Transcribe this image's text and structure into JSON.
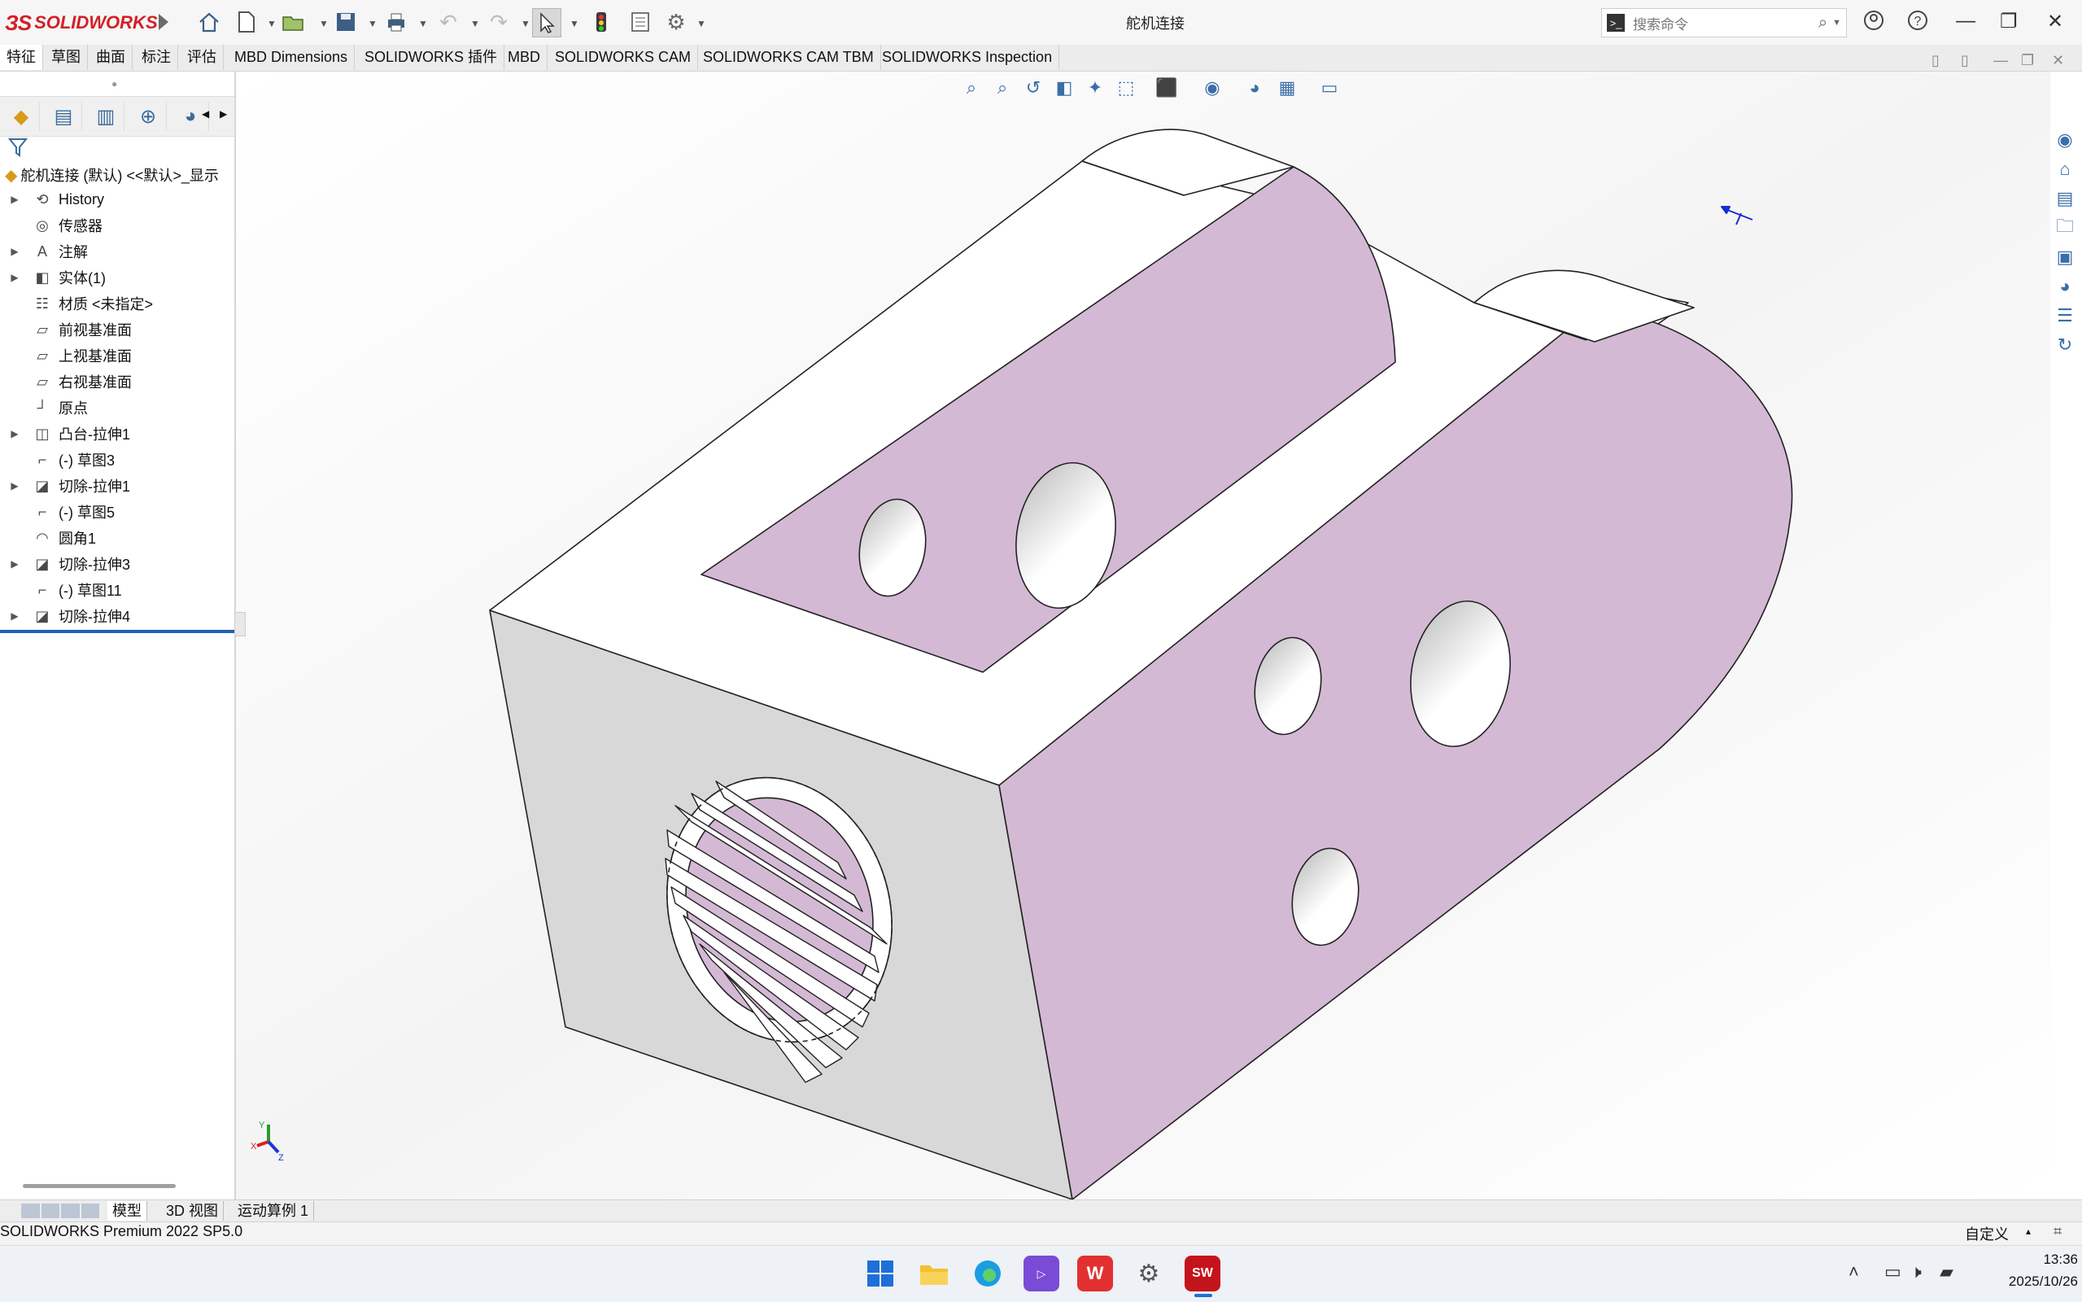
{
  "app": {
    "logo_ds": "ЗS",
    "logo_text": "SOLIDWORKS",
    "document_title": "舵机连接",
    "search_placeholder": "搜索命令"
  },
  "command_tabs": [
    "特征",
    "草图",
    "曲面",
    "标注",
    "评估",
    "MBD Dimensions",
    "SOLIDWORKS 插件",
    "MBD",
    "SOLIDWORKS CAM",
    "SOLIDWORKS CAM TBM",
    "SOLIDWORKS Inspection"
  ],
  "feature_tree": {
    "root": "舵机连接 (默认) <<默认>_显示",
    "items": [
      {
        "label": "History",
        "icon": "history-icon",
        "expandable": true
      },
      {
        "label": "传感器",
        "icon": "sensor-icon",
        "expandable": false
      },
      {
        "label": "注解",
        "icon": "annotation-icon",
        "expandable": true
      },
      {
        "label": "实体(1)",
        "icon": "solid-bodies-icon",
        "expandable": true
      },
      {
        "label": "材质 <未指定>",
        "icon": "material-icon",
        "expandable": false
      },
      {
        "label": "前视基准面",
        "icon": "plane-icon",
        "expandable": false
      },
      {
        "label": "上视基准面",
        "icon": "plane-icon",
        "expandable": false
      },
      {
        "label": "右视基准面",
        "icon": "plane-icon",
        "expandable": false
      },
      {
        "label": "原点",
        "icon": "origin-icon",
        "expandable": false
      },
      {
        "label": "凸台-拉伸1",
        "icon": "boss-extrude-icon",
        "expandable": true
      },
      {
        "label": "(-) 草图3",
        "icon": "sketch-icon",
        "expandable": false
      },
      {
        "label": "切除-拉伸1",
        "icon": "cut-extrude-icon",
        "expandable": true
      },
      {
        "label": "(-) 草图5",
        "icon": "sketch-icon",
        "expandable": false
      },
      {
        "label": "圆角1",
        "icon": "fillet-icon",
        "expandable": false
      },
      {
        "label": "切除-拉伸3",
        "icon": "cut-extrude-icon",
        "expandable": true
      },
      {
        "label": "(-) 草图11",
        "icon": "sketch-icon",
        "expandable": false
      },
      {
        "label": "切除-拉伸4",
        "icon": "cut-extrude-icon",
        "expandable": true
      }
    ]
  },
  "bottom_tabs": [
    "模型",
    "3D 视图",
    "运动算例 1"
  ],
  "status": {
    "left": "SOLIDWORKS Premium 2022 SP5.0",
    "units": "自定义"
  },
  "triad": {
    "x": "X",
    "y": "Y",
    "z": "Z"
  },
  "taskbar": {
    "time": "13:36",
    "date": "2025/10/26",
    "sw_badge": "SW"
  },
  "colors": {
    "part_face": "#d4b9d5",
    "part_white": "#ffffff",
    "part_grey": "#d8d8d8",
    "brand_red": "#d21f26",
    "rollback_bar": "#1f5fb4"
  }
}
